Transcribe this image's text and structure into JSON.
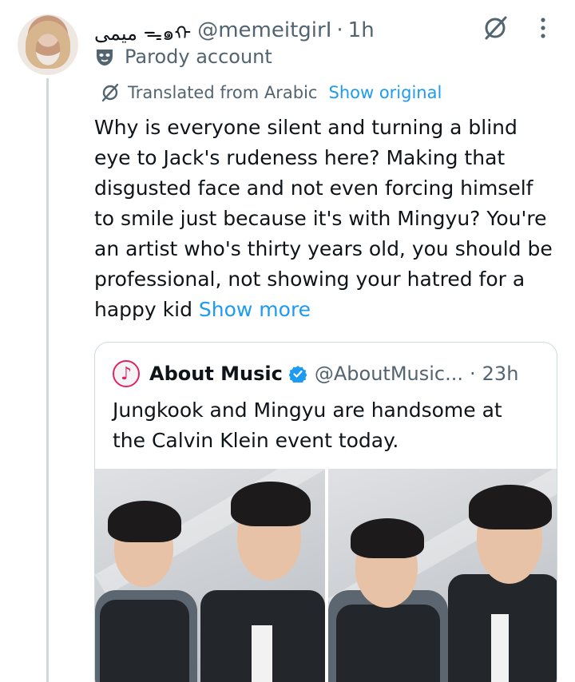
{
  "post": {
    "display_name": "ميمى ᯓ๑ᡣ",
    "handle": "@memeitgirI",
    "separator": "·",
    "time": "1h",
    "parody_label": "Parody account",
    "translated_label": "Translated from Arabic",
    "show_original": "Show original",
    "text_lines": [
      "Why is everyone silent and turning a blind",
      "eye to Jack's rudeness here? Making that",
      "disgusted face and not even forcing himself",
      "to smile just because it's with Mingyu? You're",
      "an artist who's thirty years old, you should be",
      "professional, not showing your hatred for a"
    ],
    "last_line": "happy kid",
    "show_more": "Show more"
  },
  "quote": {
    "name": "About Music",
    "handle": "@AboutMusic...",
    "separator": "·",
    "time": "23h",
    "text_lines": [
      "Jungkook and Mingyu are handsome at",
      "the Calvin Klein event today."
    ]
  },
  "icons": {
    "grok": "grok-icon",
    "more": "more-vertical-icon",
    "parody": "theater-mask-icon",
    "translate": "translate-icon",
    "verified": "verified-badge-icon",
    "music_note": "music-note-icon"
  },
  "colors": {
    "accent": "#1d9bf0",
    "secondary_text": "#536471",
    "primary_text": "#0f1419",
    "border": "#cfd9de"
  }
}
